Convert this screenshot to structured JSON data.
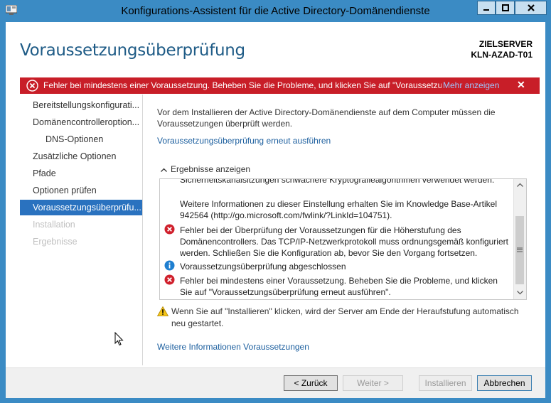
{
  "window": {
    "title": "Konfigurations-Assistent für die Active Directory-Domänendienste"
  },
  "header": {
    "page_title": "Voraussetzungsüberprüfung",
    "target_label": "ZIELSERVER",
    "target_server": "KLN-AZAD-T01"
  },
  "error_bar": {
    "icon": "error-icon",
    "message": "Fehler bei mindestens einer Voraussetzung. Beheben Sie die Probleme, und klicken Sie auf \"Voraussetzu...",
    "link": "Mehr anzeigen",
    "close": "✕"
  },
  "nav": {
    "items": [
      {
        "label": "Bereitstellungskonfigurati..."
      },
      {
        "label": "Domänencontrolleroption..."
      },
      {
        "label": "DNS-Optionen"
      },
      {
        "label": "Zusätzliche Optionen"
      },
      {
        "label": "Pfade"
      },
      {
        "label": "Optionen prüfen"
      },
      {
        "label": "Voraussetzungsüberprüfu..."
      },
      {
        "label": "Installation"
      },
      {
        "label": "Ergebnisse"
      }
    ]
  },
  "main": {
    "intro": "Vor dem Installieren der Active Directory-Domänendienste auf dem Computer müssen die Voraussetzungen überprüft werden.",
    "rerun_link": "Voraussetzungsüberprüfung erneut ausführen",
    "results_header": "Ergebnisse anzeigen",
    "results": {
      "clipped_line": "Sicherheitskanalsitzungen schwächere Kryptografiealgorithmen verwendet werden.",
      "info_more": "Weitere Informationen zu dieser Einstellung erhalten Sie im Knowledge Base-Artikel 942564 (http://go.microsoft.com/fwlink/?LinkId=104751).",
      "error1": "Fehler bei der Überprüfung der Voraussetzungen für die Höherstufung des Domänencontrollers. Das TCP/IP-Netzwerkprotokoll muss ordnungsgemäß konfiguriert werden. Schließen Sie die Konfiguration ab, bevor Sie den Vorgang fortsetzen.",
      "info_done": "Voraussetzungsüberprüfung abgeschlossen",
      "error2": "Fehler bei mindestens einer Voraussetzung. Beheben Sie die Probleme, und klicken Sie auf \"Voraussetzungsüberprüfung erneut ausführen\"."
    },
    "warning": "Wenn Sie auf \"Installieren\" klicken, wird der Server am Ende der Heraufstufung automatisch neu gestartet.",
    "more_info_link": "Weitere Informationen Voraussetzungen"
  },
  "footer": {
    "back": "< Zurück",
    "next": "Weiter >",
    "install": "Installieren",
    "cancel": "Abbrechen"
  }
}
